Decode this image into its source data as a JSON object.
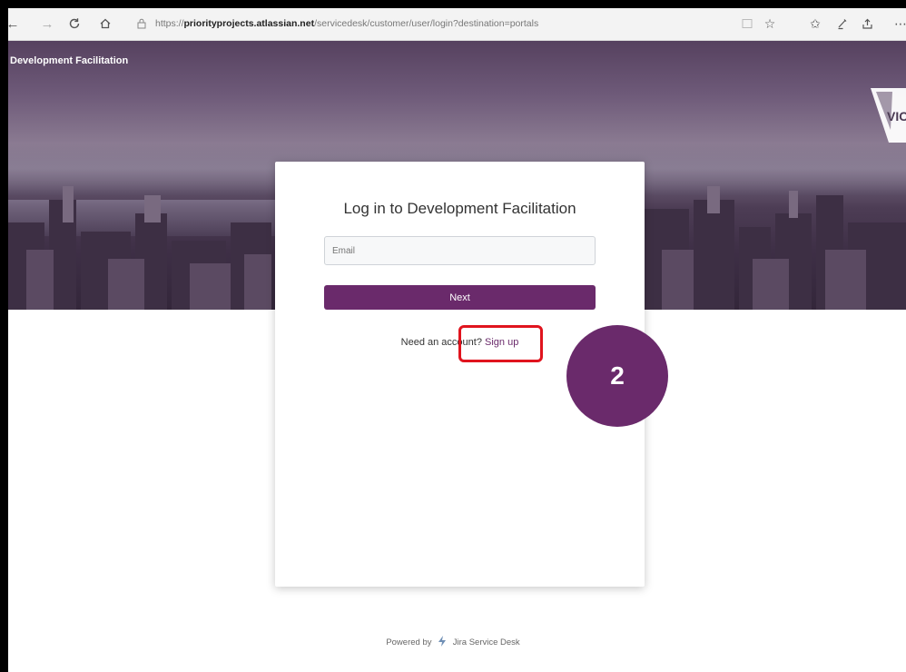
{
  "browser": {
    "url_prefix": "https://",
    "url_host": "priorityprojects.atlassian.net",
    "url_path": "/servicedesk/customer/user/login?destination=portals",
    "icons": [
      "back-icon",
      "forward-icon",
      "refresh-icon",
      "home-icon",
      "lock-icon",
      "reading-view-icon",
      "favorite-icon",
      "favorites-bar-icon",
      "pen-icon",
      "share-icon",
      "more-icon"
    ]
  },
  "site": {
    "name": "Development Facilitation",
    "logo_text": "VIC"
  },
  "login": {
    "title": "Log in to Development Facilitation",
    "email_placeholder": "Email",
    "next_label": "Next",
    "need_account_text": "Need an account? ",
    "signup_label": "Sign up"
  },
  "annotation": {
    "step_number": "2",
    "highlight_color": "#e0141e",
    "badge_color": "#6a2a6b"
  },
  "footer": {
    "powered_by": "Powered by",
    "product": "Jira Service Desk"
  },
  "colors": {
    "brand": "#6a2a6b"
  }
}
